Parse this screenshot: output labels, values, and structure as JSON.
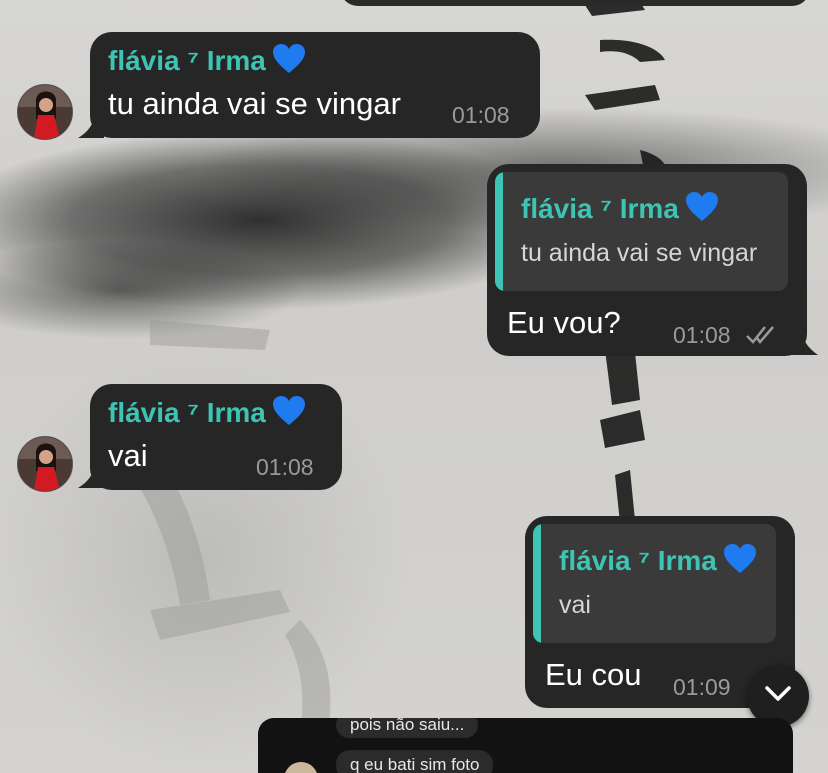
{
  "chat": {
    "messages": [
      {
        "direction": "incoming",
        "sender": "flávia ⁷ Irma",
        "text": "tu ainda vai se vingar",
        "time": "01:08"
      },
      {
        "direction": "outgoing",
        "quote_sender": "flávia ⁷ Irma",
        "quote_text": "tu ainda vai se vingar",
        "text": "Eu vou?",
        "time": "01:08",
        "status": "read-double-check"
      },
      {
        "direction": "incoming",
        "sender": "flávia ⁷ Irma",
        "text": "vai",
        "time": "01:08"
      },
      {
        "direction": "outgoing",
        "quote_sender": "flávia ⁷ Irma",
        "quote_text": "vai",
        "text": "Eu cou",
        "time": "01:09"
      }
    ],
    "heart_emoji_color": "#1e7bf0",
    "sender_color": "#3ec4b2",
    "bubble_color": "#262626"
  },
  "preview_panel": {
    "line1": "pois não saiu...",
    "line2": "q eu bati sim foto"
  },
  "icons": {
    "scroll_down": "chevron-down-icon",
    "read_receipt": "double-check-icon",
    "heart": "blue-heart-icon"
  }
}
